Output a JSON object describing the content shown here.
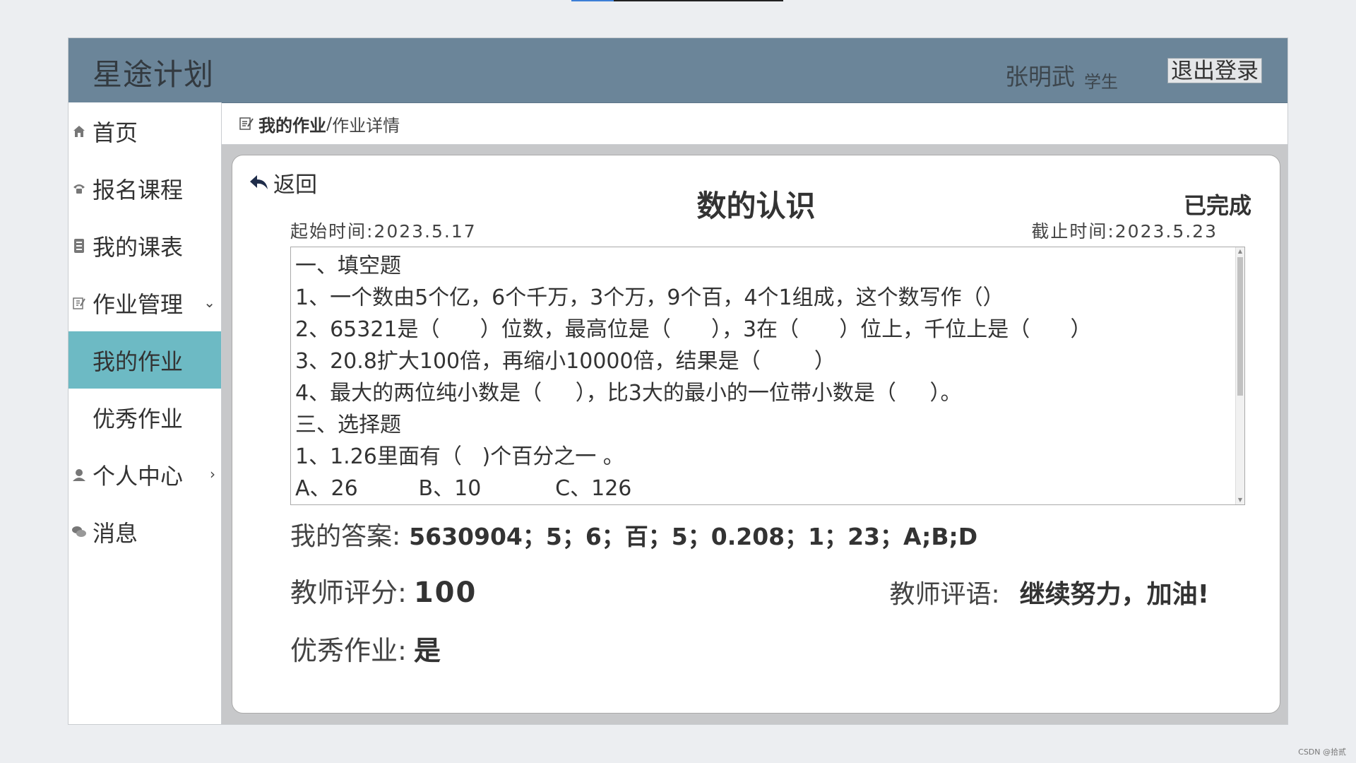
{
  "app": {
    "brand": "星途计划",
    "user_name": "张明武",
    "user_role": "学生",
    "logout_label": "退出登录"
  },
  "sidebar": {
    "items": [
      {
        "label": "首页",
        "icon": "home-icon"
      },
      {
        "label": "报名课程",
        "icon": "phone-icon"
      },
      {
        "label": "我的课表",
        "icon": "book-icon"
      },
      {
        "label": "作业管理",
        "icon": "edit-icon",
        "chevron": "⌄"
      },
      {
        "label": "我的作业",
        "active": true
      },
      {
        "label": "优秀作业"
      },
      {
        "label": "个人中心",
        "icon": "user-icon",
        "chevron": "›"
      },
      {
        "label": "消息",
        "icon": "chat-icon"
      }
    ]
  },
  "breadcrumb": {
    "parent": "我的作业",
    "separator": "/",
    "current": "作业详情"
  },
  "homework": {
    "back_label": "返回",
    "title": "数的认识",
    "status": "已完成",
    "start_time": "起始时间:2023.5.17",
    "end_time": "截止时间:2023.5.23",
    "questions": [
      "一、填空题",
      "1、一个数由5个亿，6个千万，3个万，9个百，4个1组成，这个数写作（）",
      "2、65321是（      ）位数，最高位是（      ），3在（      ）位上，千位上是（      ）",
      "3、20.8扩大100倍，再缩小10000倍，结果是（        ）",
      "4、最大的两位纯小数是（     ），比3大的最小的一位带小数是（     ）。",
      "三、选择题",
      "1、1.26里面有（   )个百分之一 。",
      "A、26         B、10           C、126"
    ],
    "answer_label": "我的答案:",
    "answer_value": "5630904；5；6；百；5；0.208；1；23；A;B;D",
    "score_label": "教师评分:",
    "score_value": "100",
    "comment_label": "教师评语:",
    "comment_value": "继续努力，加油!",
    "excellent_label": "优秀作业:",
    "excellent_value": "是"
  },
  "watermark": "CSDN @拾贰",
  "colors": {
    "header_bg": "#6b8599",
    "active_item_bg": "#6dbac4",
    "content_bg": "#c7c8ca"
  }
}
